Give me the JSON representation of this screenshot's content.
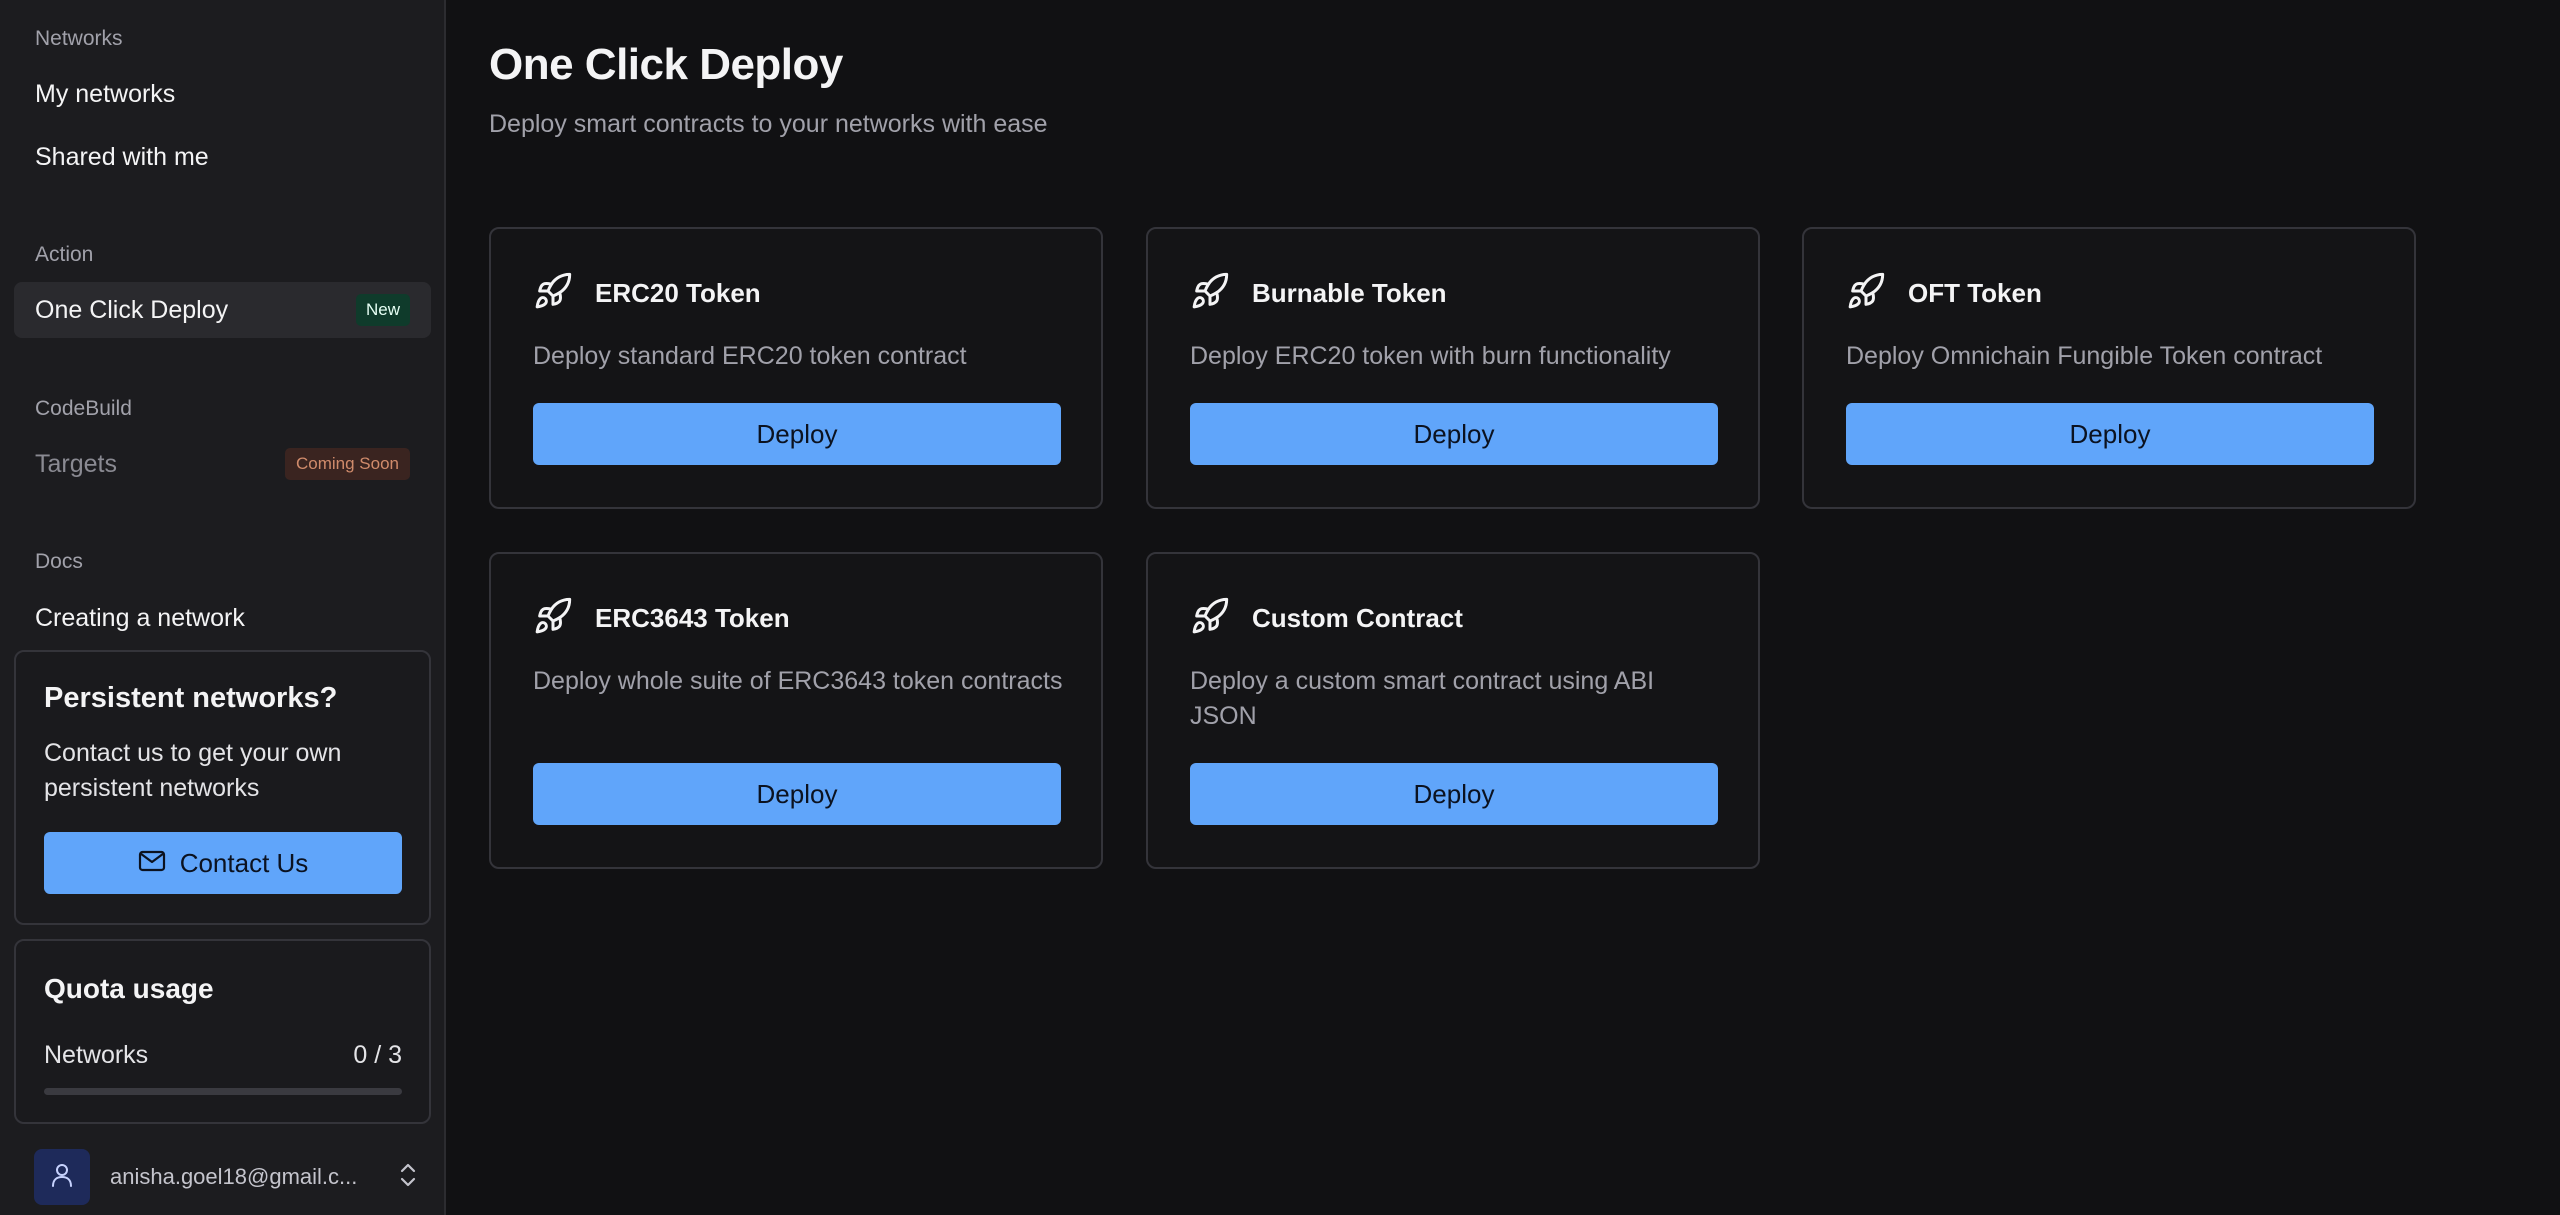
{
  "sidebar": {
    "sections": {
      "networks": "Networks",
      "action": "Action",
      "codebuild": "CodeBuild",
      "docs": "Docs"
    },
    "items": {
      "my_networks": "My networks",
      "shared": "Shared with me",
      "one_click": "One Click Deploy",
      "one_click_badge": "New",
      "targets": "Targets",
      "targets_badge": "Coming Soon",
      "creating": "Creating a network"
    },
    "persistent": {
      "title": "Persistent networks?",
      "text": "Contact us to get your own persistent networks",
      "button": "Contact Us"
    },
    "quota": {
      "title": "Quota usage",
      "label": "Networks",
      "value": "0 / 3",
      "used_fraction": 0
    },
    "user": {
      "email": "anisha.goel18@gmail.c..."
    }
  },
  "main": {
    "title": "One Click Deploy",
    "subtitle": "Deploy smart contracts to your networks with ease",
    "cards": [
      {
        "name": "ERC20 Token",
        "desc": "Deploy standard ERC20 token contract",
        "button": "Deploy"
      },
      {
        "name": "Burnable Token",
        "desc": "Deploy ERC20 token with burn functionality",
        "button": "Deploy"
      },
      {
        "name": "OFT Token",
        "desc": "Deploy Omnichain Fungible Token contract",
        "button": "Deploy"
      },
      {
        "name": "ERC3643 Token",
        "desc": "Deploy whole suite of ERC3643 token contracts",
        "button": "Deploy"
      },
      {
        "name": "Custom Contract",
        "desc": "Deploy a custom smart contract using ABI JSON",
        "button": "Deploy"
      }
    ]
  },
  "colors": {
    "accent": "#60a5fa",
    "background": "#111113",
    "sidebar": "#1c1c1f"
  },
  "icons": {
    "card": "rocket-icon",
    "contact": "mail-icon",
    "avatar": "user-icon",
    "account_menu": "chevrons-up-down-icon"
  }
}
